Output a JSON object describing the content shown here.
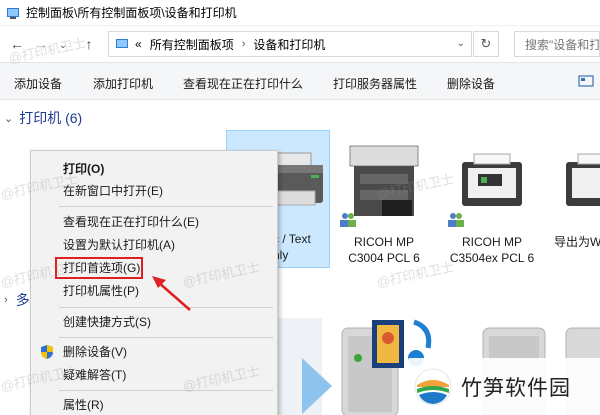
{
  "window": {
    "title": "控制面板\\所有控制面板项\\设备和打印机"
  },
  "address": {
    "overflow": "«",
    "crumbs": [
      "所有控制面板项",
      "设备和打印机"
    ],
    "search_placeholder": "搜索\"设备和打"
  },
  "toolbar": {
    "items": [
      "添加设备",
      "添加打印机",
      "查看现在正在打印什么",
      "打印服务器属性",
      "删除设备"
    ]
  },
  "groups": {
    "printers": "打印机 (6)",
    "multimedia_partial": "多"
  },
  "printers": [
    {
      "line1": "c / Text",
      "line2": "nly"
    },
    {
      "line1": "RICOH MP",
      "line2": "C3004 PCL 6"
    },
    {
      "line1": "RICOH MP",
      "line2": "C3504ex PCL 6"
    },
    {
      "line1": "导出为W",
      "line2": ""
    }
  ],
  "context_menu": {
    "items": [
      {
        "label": "打印(O)",
        "bold": true
      },
      {
        "label": "在新窗口中打开(E)"
      },
      {
        "label": "查看现在正在打印什么(E)"
      },
      {
        "label": "设置为默认打印机(A)"
      },
      {
        "label": "打印首选项(G)"
      },
      {
        "label": "打印机属性(P)"
      },
      {
        "label": "创建快捷方式(S)"
      },
      {
        "label": "删除设备(V)"
      },
      {
        "label": "疑难解答(T)"
      },
      {
        "label": "属性(R)"
      }
    ]
  },
  "watermark": "@打印机卫士",
  "brand": {
    "name": "竹笋软件园"
  },
  "colors": {
    "selection": "#cce8ff",
    "highlight_red": "#e02020",
    "group_header": "#1f3a93"
  }
}
